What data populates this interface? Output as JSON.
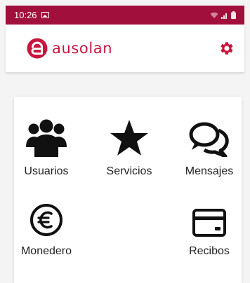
{
  "status_bar": {
    "time": "10:26",
    "background": "#a10f3c"
  },
  "app_bar": {
    "logo_text": "ausolan",
    "brand_color": "#c8163e",
    "settings_icon": "gear-icon"
  },
  "menu": {
    "tiles": [
      {
        "label": "Usuarios",
        "icon": "users-icon"
      },
      {
        "label": "Servicios",
        "icon": "star-icon"
      },
      {
        "label": "Mensajes",
        "icon": "chat-bubbles-icon"
      },
      {
        "label": "Monedero",
        "icon": "euro-icon"
      },
      {
        "label": "Recibos",
        "icon": "credit-card-icon"
      }
    ]
  }
}
